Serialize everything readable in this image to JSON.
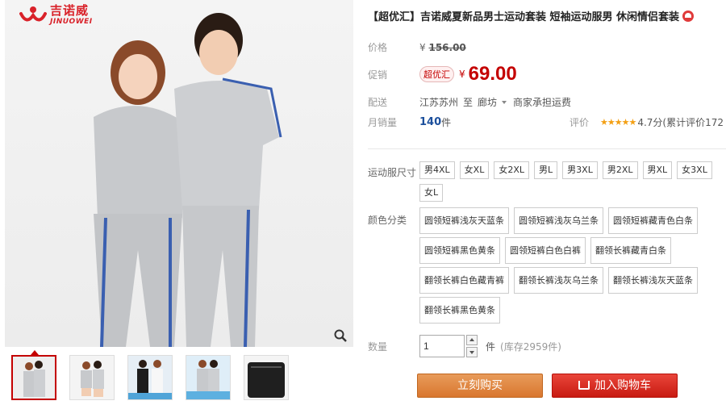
{
  "brand": {
    "name_cn": "吉诺威",
    "name_en": "JINUOWEI"
  },
  "product": {
    "title": "【超优汇】吉诺威夏新品男士运动套装 短袖运动服男 休闲情侣套装"
  },
  "price": {
    "label": "价格",
    "currency": "¥",
    "original": "156.00"
  },
  "promo": {
    "label": "促销",
    "tag": "超优汇",
    "currency": "¥",
    "price": "69.00"
  },
  "shipping": {
    "label": "配送",
    "from": "江苏苏州",
    "to_word": "至",
    "to": "廊坊",
    "fee": "商家承担运费"
  },
  "sales": {
    "label": "月销量",
    "count": "140",
    "unit": "件"
  },
  "rating": {
    "label": "评价",
    "stars": "★★★★★",
    "text": "4.7分(累计评价172"
  },
  "sizes": {
    "label": "运动服尺寸",
    "options": [
      "男4XL",
      "女XL",
      "女2XL",
      "男L",
      "男3XL",
      "男2XL",
      "男XL",
      "女3XL",
      "女L"
    ]
  },
  "colors": {
    "label": "颜色分类",
    "options": [
      "圆领短裤浅灰天蓝条",
      "圆领短裤浅灰乌兰条",
      "圆领短裤藏青色白条",
      "圆领短裤黑色黄条",
      "圆领短裤白色白裤",
      "翻领长裤藏青白条",
      "翻领长裤白色藏青裤",
      "翻领长裤浅灰乌兰条",
      "翻领长裤浅灰天蓝条",
      "翻领长裤黑色黄条"
    ]
  },
  "quantity": {
    "label": "数量",
    "value": "1",
    "unit": "件",
    "stock": "(库存2959件)"
  },
  "actions": {
    "buy": "立刻购买",
    "cart": "加入购物车"
  },
  "icons": {
    "zoom": "magnifier-icon",
    "cart": "cart-icon",
    "badge": "medal-icon"
  },
  "colors_theme": {
    "accent": "#c40000",
    "buy": "#d9772f",
    "cart": "#c81b12"
  }
}
